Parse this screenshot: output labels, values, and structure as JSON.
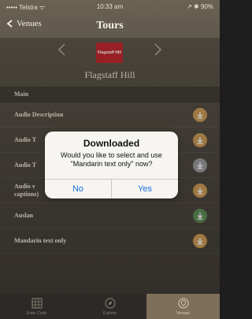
{
  "status": {
    "carrier": "••••• Telstra ᯤ",
    "time": "10:33 am",
    "battery": "↗ ✱ 90%"
  },
  "nav": {
    "back_label": "Venues",
    "title": "Tours"
  },
  "header": {
    "place_title": "Flagstaff Hill",
    "logo_text": "Flagstaff Hill"
  },
  "section": {
    "title": "Main"
  },
  "rows": [
    {
      "label": "Audio Description",
      "state": "available"
    },
    {
      "label": "Audio T",
      "state": "available"
    },
    {
      "label": "Audio T",
      "state": "disabled"
    },
    {
      "label": "Audio v",
      "sub": "captions)",
      "state": "available"
    },
    {
      "label": "Auslan",
      "state": "downloaded"
    },
    {
      "label": "Mandarin text only",
      "state": "available"
    }
  ],
  "dialog": {
    "title": "Downloaded",
    "message": "Would you like to select and use \"Mandarin text only\" now?",
    "no": "No",
    "yes": "Yes"
  },
  "tabs": [
    {
      "label": "Enter Code"
    },
    {
      "label": "Explore"
    },
    {
      "label": "Venues"
    }
  ],
  "colors": {
    "download_available": "#c99a55",
    "download_disabled": "#9a9a9a",
    "download_done": "#5f8a57",
    "dialog_accent": "#1a6fe0"
  }
}
